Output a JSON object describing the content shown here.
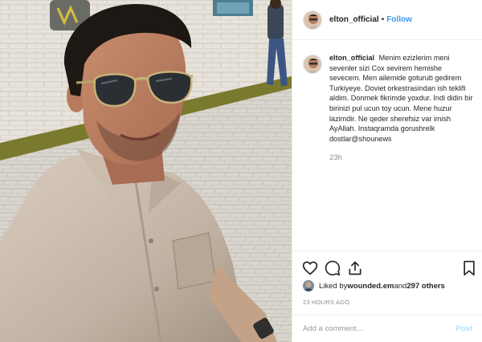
{
  "post": {
    "username": "elton_official",
    "separator": "•",
    "follow_label": "Follow",
    "caption": "Menim ezizlerim meni sevenler sizi Cox sevirem hemishe sevecem. Men ailemide goturub gedirem Turkiyeye. Doviet orkestrasindan ish teklifi aldim. Donmek fikrimde yoxdur. Indi didin bir birinizi pul ucun toy ucun. Mene huzur lazimdir. Ne qeder sherefsiz var imish AyAllah. Instaqramda gorushrelk dostlar@shounews",
    "caption_time": "23h",
    "liked_by_prefix": "Liked by ",
    "liked_by_user": "wounded.em",
    "liked_by_and": " and ",
    "likes_others": "297 others",
    "posted_time": "23 HOURS AGO",
    "comment_placeholder": "Add a comment…",
    "post_label": "Post"
  },
  "icons": {
    "like": "heart-icon",
    "comment": "comment-bubble-icon",
    "share": "share-icon",
    "save": "bookmark-icon"
  },
  "colors": {
    "follow": "#3897f0",
    "post_disabled": "#b2dffc",
    "meta_gray": "#8e8e8e"
  }
}
